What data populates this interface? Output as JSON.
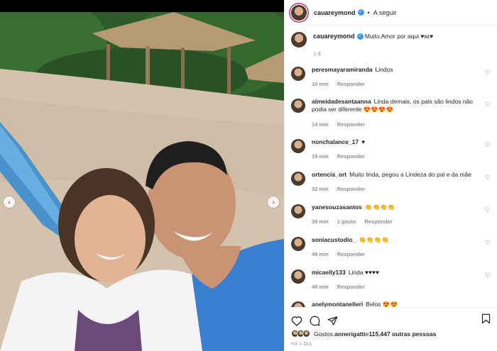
{
  "post": {
    "username": "cauareymond",
    "follow_label": "A seguir",
    "dot": "•",
    "caption_text": "Muito Amor por aqui ♥ɴɪ♥",
    "caption_time": "1 d"
  },
  "comments": [
    {
      "user": "peresmayaramiranda",
      "text": "Lindos",
      "time": "10 min",
      "reply": "Responder",
      "likes": ""
    },
    {
      "user": "almeidadesantaanna",
      "text": "Linda demais, os pais são lindos não podia ser diferente 😍😍😍😍",
      "time": "14 min",
      "reply": "Responder",
      "likes": ""
    },
    {
      "user": "nonchalance_17",
      "text": "♥",
      "time": "19 min",
      "reply": "Responder",
      "likes": ""
    },
    {
      "user": "ortencia_ort",
      "text": "Muito linda, pegou a Lindeza do pai e da mãe",
      "time": "32 min",
      "reply": "Responder",
      "likes": ""
    },
    {
      "user": "yanesouzasantos",
      "text": "👏👏👏👏",
      "time": "39 min",
      "reply": "Responder",
      "likes": "1 gosto"
    },
    {
      "user": "soniacustodio_",
      "text": "👏👏👏👏",
      "time": "48 min",
      "reply": "Responder",
      "likes": ""
    },
    {
      "user": "micaelly133",
      "text": "Linda ♥♥♥♥",
      "time": "48 min",
      "reply": "Responder",
      "likes": ""
    },
    {
      "user": "anelymontanelleri",
      "text": "Belos 😍😍",
      "time": "",
      "reply": "",
      "likes": ""
    }
  ],
  "likes_line": {
    "prefix": "Gostos: ",
    "first_user": "annerigatti",
    "middle": " e ",
    "count": "115.447 outras pessoas"
  },
  "post_time": "HÁ 1 DIA",
  "icons": {
    "like": "heart-icon",
    "comment": "comment-icon",
    "share": "share-icon",
    "save": "bookmark-icon",
    "prev": "chevron-left-icon",
    "next": "chevron-right-icon"
  },
  "colors": {
    "verified": "#3897f0",
    "muted": "#8e8e8e",
    "text": "#262626",
    "story_ring": "#d62976"
  }
}
